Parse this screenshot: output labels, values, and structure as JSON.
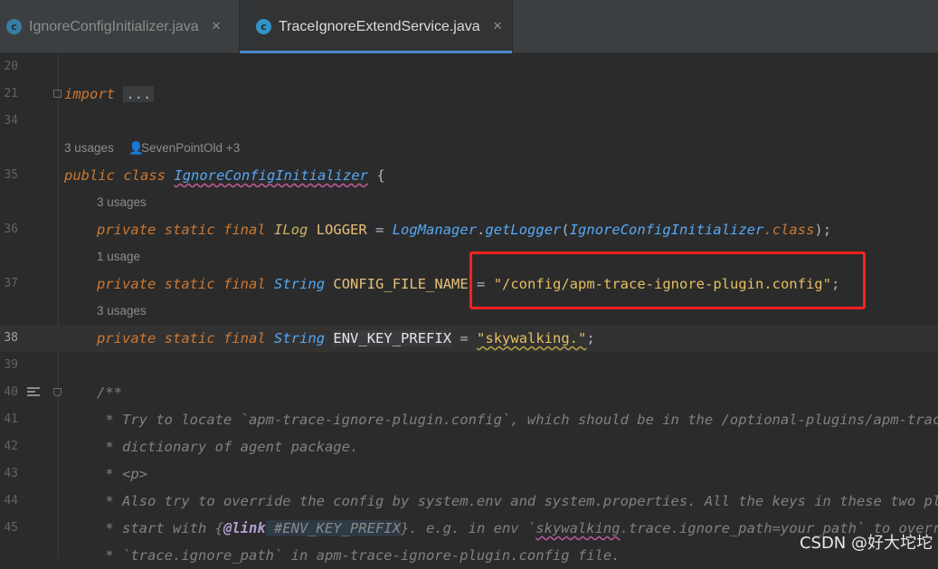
{
  "tabs": [
    {
      "label": "IgnoreConfigInitializer.java",
      "icon": "c",
      "active": false
    },
    {
      "label": "TraceIgnoreExtendService.java",
      "icon": "c",
      "active": true
    }
  ],
  "close_glyph": "✕",
  "lines": {
    "n20": "20",
    "n21": "21",
    "n34": "34",
    "n35": "35",
    "n36": "36",
    "n37": "37",
    "n38": "38",
    "n39": "39",
    "n40": "40",
    "n41": "41",
    "n42": "42",
    "n43": "43",
    "n44": "44",
    "n45": "45"
  },
  "code": {
    "import_kw": "import",
    "import_fold": "...",
    "class_hint_usages": "3 usages",
    "class_hint_author": "SevenPointOld +3",
    "public": "public",
    "class": "class",
    "class_name": "IgnoreConfigInitializer",
    "brace_open": " {",
    "hint36": "3 usages",
    "hint37": "1 usage",
    "hint38": "3 usages",
    "private": "private",
    "static": "static",
    "final": "final",
    "ilog": "ILog",
    "logger": "LOGGER",
    "eq": " = ",
    "logmanager": "LogManager",
    "getlogger": "getLogger",
    "paren_open": "(",
    "class_ref": "IgnoreConfigInitializer",
    "dot_class": ".class",
    "paren_close_semi": ");",
    "string_type": "String",
    "config_file_name": "CONFIG_FILE_NAME",
    "config_value": "\"/config/apm-trace-ignore-plugin.config\"",
    "semi": ";",
    "env_key_prefix": "ENV_KEY_PREFIX",
    "env_value": "\"skywalking.\"",
    "c40": "/**",
    "c41": " * Try to locate `apm-trace-ignore-plugin.config`, which should be in the /optional-plugins/apm-trace-ig",
    "c42": " * dictionary of agent package.",
    "c43": " * <p>",
    "c44": " * Also try to override the config by system.env and system.properties. All the keys in these two places",
    "c45_a": " * start with {",
    "c45_link": "@link",
    "c45_ref": " #ENV_KEY_PREFIX",
    "c45_b": "}. e.g. in env `",
    "c45_c": "skywalking",
    "c45_d": ".trace.ignore_path=your_path` to override",
    "c46": " * `trace.ignore_path` in apm-trace-ignore-plugin.config file."
  },
  "watermark": "CSDN @好大坨坨"
}
